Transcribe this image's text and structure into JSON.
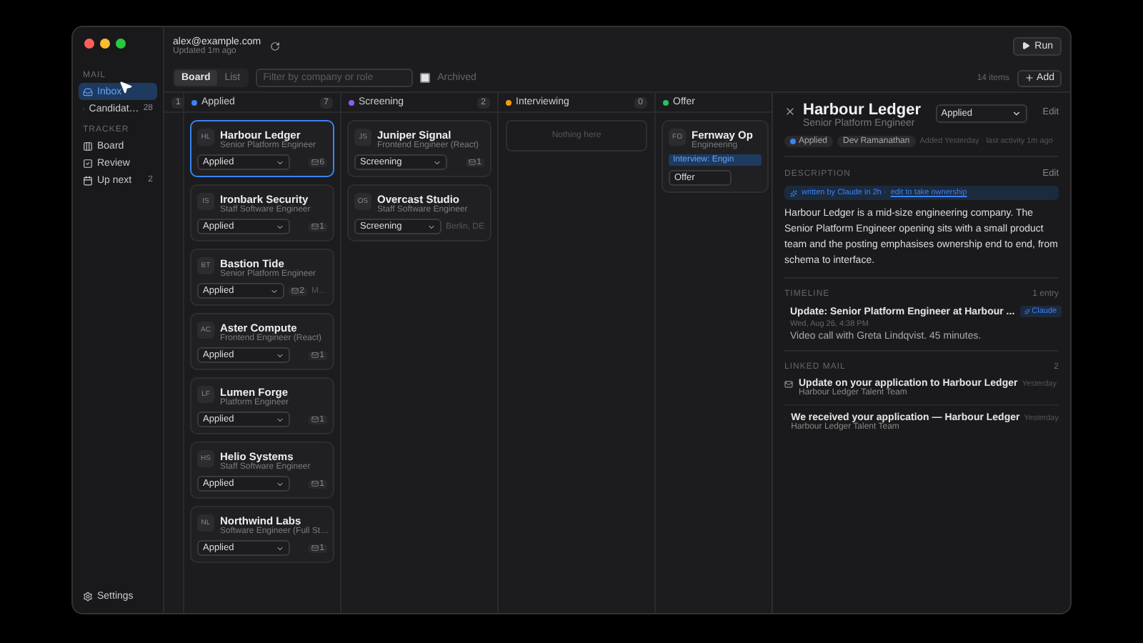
{
  "window": {
    "account": "alex@example.com",
    "updated": "Updated 1m ago"
  },
  "run_button": {
    "label": "Run"
  },
  "sidebar": {
    "sections": [
      {
        "title": "MAIL",
        "items": [
          {
            "label": "Inbox",
            "selected": true
          },
          {
            "label": "Candidat…",
            "count": "28",
            "selected": false
          }
        ]
      },
      {
        "title": "TRACKER",
        "items": [
          {
            "label": "Board",
            "selected": false
          },
          {
            "label": "Review",
            "selected": false
          },
          {
            "label": "Up next",
            "count": "2",
            "selected": false
          }
        ]
      }
    ],
    "settings": "Settings"
  },
  "toolbar": {
    "views": [
      {
        "label": "Board",
        "selected": true
      },
      {
        "label": "List",
        "selected": false
      }
    ],
    "filter": {
      "placeholder": "Filter by company or role"
    },
    "archived": {
      "label": "Archived",
      "checked": false
    },
    "item_count": "14 items",
    "add_button": "Add"
  },
  "columns": [
    {
      "kind": "collapsed",
      "count": "1"
    },
    {
      "kind": "stage",
      "title": "Applied",
      "color": "#3b82f6",
      "count": "7",
      "cards": [
        {
          "initials": "HL",
          "company": "Harbour Ledger",
          "role": "Senior Platform Engineer",
          "stage": "Applied",
          "mail_count": "6",
          "selected": true
        },
        {
          "initials": "IS",
          "company": "Ironbark Security",
          "role": "Staff Software Engineer",
          "stage": "Applied",
          "mail_count": "1",
          "selected": false
        },
        {
          "initials": "BT",
          "company": "Bastion Tide",
          "role": "Senior Platform Engineer",
          "stage": "Applied",
          "mail_count": "2",
          "location": "M…",
          "selected": false
        },
        {
          "initials": "AC",
          "company": "Aster Compute",
          "role": "Frontend Engineer (React)",
          "stage": "Applied",
          "mail_count": "1",
          "selected": false
        },
        {
          "initials": "LF",
          "company": "Lumen Forge",
          "role": "Platform Engineer",
          "stage": "Applied",
          "mail_count": "1",
          "selected": false
        },
        {
          "initials": "HS",
          "company": "Helio Systems",
          "role": "Staff Software Engineer",
          "stage": "Applied",
          "mail_count": "1",
          "selected": false
        },
        {
          "initials": "NL",
          "company": "Northwind Labs",
          "role": "Software Engineer (Full St…",
          "stage": "Applied",
          "mail_count": "1",
          "selected": false
        }
      ]
    },
    {
      "kind": "stage",
      "title": "Screening",
      "color": "#8b5cf6",
      "count": "2",
      "cards": [
        {
          "initials": "JS",
          "company": "Juniper Signal",
          "role": "Frontend Engineer (React)",
          "stage": "Screening",
          "mail_count": "1",
          "selected": false
        },
        {
          "initials": "OS",
          "company": "Overcast Studio",
          "role": "Staff Software Engineer",
          "stage": "Screening",
          "location": "Berlin, DE",
          "selected": false
        }
      ]
    },
    {
      "kind": "stage",
      "title": "Interviewing",
      "color": "#f59e0b",
      "count": "0",
      "empty_text": "Nothing here"
    },
    {
      "kind": "stage",
      "title": "Offer",
      "color": "#22c55e",
      "cards": [
        {
          "initials": "FO",
          "company": "Fernway Op",
          "role": "Engineering",
          "tag": "Interview: Engin",
          "stage": "Offer",
          "selected": false
        }
      ]
    }
  ],
  "detail": {
    "company": "Harbour Ledger",
    "role": "Senior Platform Engineer",
    "stage": "Applied",
    "edit": "Edit",
    "chips": [
      {
        "label": "Applied",
        "color": "#3b82f6"
      },
      {
        "label": "Dev Ramanathan"
      }
    ],
    "meta": "Added Yesterday · last activity 1m ago",
    "description": {
      "title": "DESCRIPTION",
      "edit": "Edit",
      "banner": "written by Claude in 2h ·",
      "banner_link": "edit to take ownership",
      "text": "Harbour Ledger is a mid-size engineering company. The Senior Platform Engineer opening sits with a small product team and the posting emphasises ownership end to end, from schema to interface."
    },
    "timeline": {
      "title": "TIMELINE",
      "count": "1 entry",
      "entries": [
        {
          "title": "Update: Senior Platform Engineer at Harbour ...",
          "badge": "Claude",
          "time": "Wed, Aug 26, 4:38 PM",
          "note": "Video call with Greta Lindqvist. 45 minutes."
        }
      ]
    },
    "mail": {
      "title": "LINKED MAIL",
      "count": "2",
      "items": [
        {
          "subject": "Update on your application to Harbour Ledger",
          "when": "Yesterday",
          "from": "Harbour Ledger Talent Team"
        },
        {
          "subject": "We received your application — Harbour Ledger",
          "when": "Yesterday",
          "from": "Harbour Ledger Talent Team"
        }
      ]
    }
  }
}
